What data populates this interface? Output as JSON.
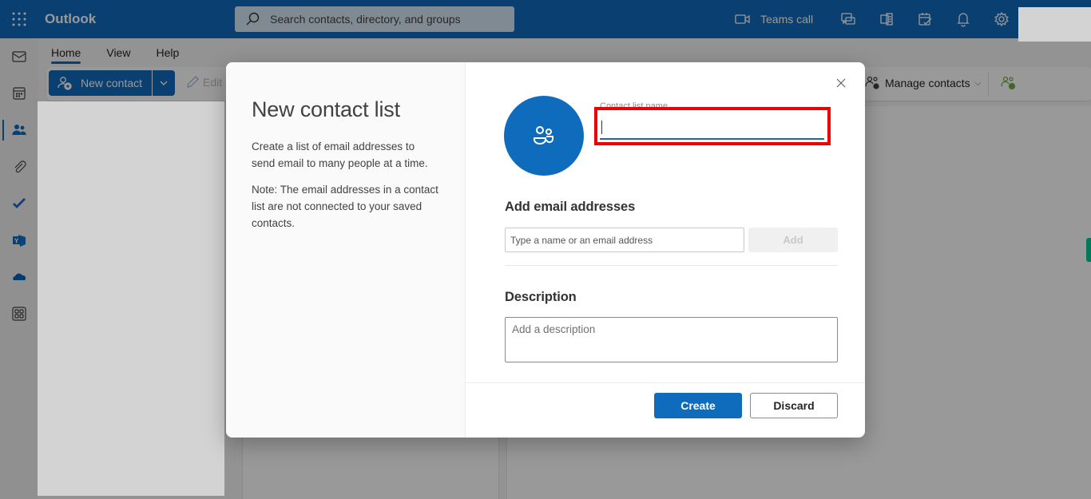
{
  "app": {
    "name": "Outlook",
    "search_placeholder": "Search contacts, directory, and groups",
    "teams_call_label": "Teams call",
    "top_icons": [
      "chat-icon",
      "onenote-icon",
      "my-day-icon",
      "bell-icon",
      "settings-icon"
    ]
  },
  "rail": {
    "items": [
      {
        "name": "mail",
        "icon": "mail-icon",
        "active": false
      },
      {
        "name": "calendar",
        "icon": "calendar-icon",
        "active": false
      },
      {
        "name": "people",
        "icon": "people-icon",
        "active": true
      },
      {
        "name": "files",
        "icon": "paperclip-icon",
        "active": false
      },
      {
        "name": "to-do",
        "icon": "checkmark-icon",
        "active": false
      },
      {
        "name": "yammer",
        "icon": "yammer-icon",
        "active": false
      },
      {
        "name": "onedrive",
        "icon": "cloud-icon",
        "active": false
      },
      {
        "name": "apps",
        "icon": "apps-icon",
        "active": false
      }
    ]
  },
  "ribbon": {
    "tabs": [
      {
        "label": "Home",
        "active": true
      },
      {
        "label": "View",
        "active": false
      },
      {
        "label": "Help",
        "active": false
      }
    ],
    "new_contact_label": "New contact",
    "edit_label": "Edit",
    "manage_contacts_label": "Manage contacts"
  },
  "dialog": {
    "title": "New contact list",
    "description": "Create a list of email addresses to send email to many people at a time.",
    "note": "Note: The email addresses in a contact list are not connected to your saved contacts.",
    "name_label": "Contact list name",
    "name_value": "",
    "add_emails_heading": "Add email addresses",
    "email_placeholder": "Type a name or an email address",
    "add_button": "Add",
    "description_heading": "Description",
    "description_placeholder": "Add a description",
    "create_button": "Create",
    "discard_button": "Discard"
  },
  "colors": {
    "brand": "#0f6cbd",
    "highlight": "#ee0000",
    "accent_green": "#00c896"
  }
}
